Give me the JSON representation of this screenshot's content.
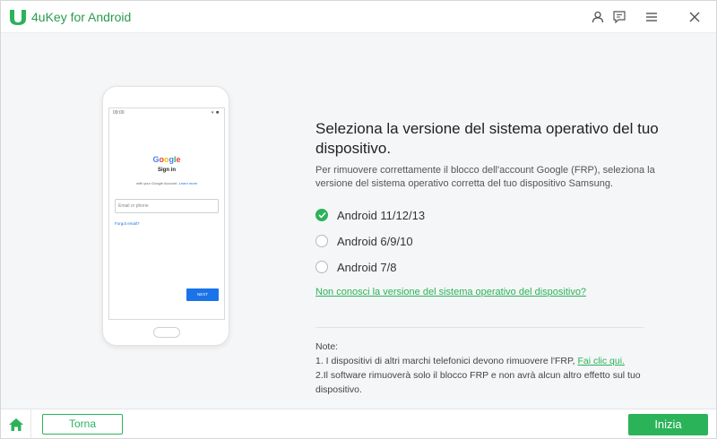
{
  "app": {
    "title": "4uKey for Android",
    "accent_color": "#2bb35a",
    "title_icons": [
      "user-icon",
      "feedback-icon",
      "menu-icon",
      "close-icon"
    ]
  },
  "phone_preview": {
    "status_time": "09:00",
    "status_icons": "▾ ◾",
    "google_logo": "Google",
    "sign_in": "Sign in",
    "subtitle": "with your Google Account. ",
    "subtitle_link": "Learn more",
    "email_placeholder": "Email or phone",
    "forgot_email": "Forgot email?",
    "next_label": "NEXT"
  },
  "content": {
    "heading": "Seleziona la versione del sistema operativo del tuo dispositivo.",
    "description": "Per rimuovere correttamente il blocco dell'account Google (FRP), seleziona la versione del sistema operativo corretta del tuo dispositivo Samsung.",
    "options": [
      {
        "label": "Android 11/12/13",
        "selected": true
      },
      {
        "label": "Android 6/9/10",
        "selected": false
      },
      {
        "label": "Android 7/8",
        "selected": false
      }
    ],
    "help_link": "Non conosci la versione del sistema operativo del dispositivo?",
    "note": {
      "title": "Note:",
      "line1": "1. I dispositivi di altri marchi telefonici devono rimuovere l'FRP, ",
      "line1_link": "Fai clic qui.",
      "line2": "2.Il software rimuoverà solo il blocco FRP e non avrà alcun altro effetto sul tuo dispositivo."
    }
  },
  "footer": {
    "home_icon": "home-icon",
    "back_label": "Torna",
    "start_label": "Inizia"
  }
}
